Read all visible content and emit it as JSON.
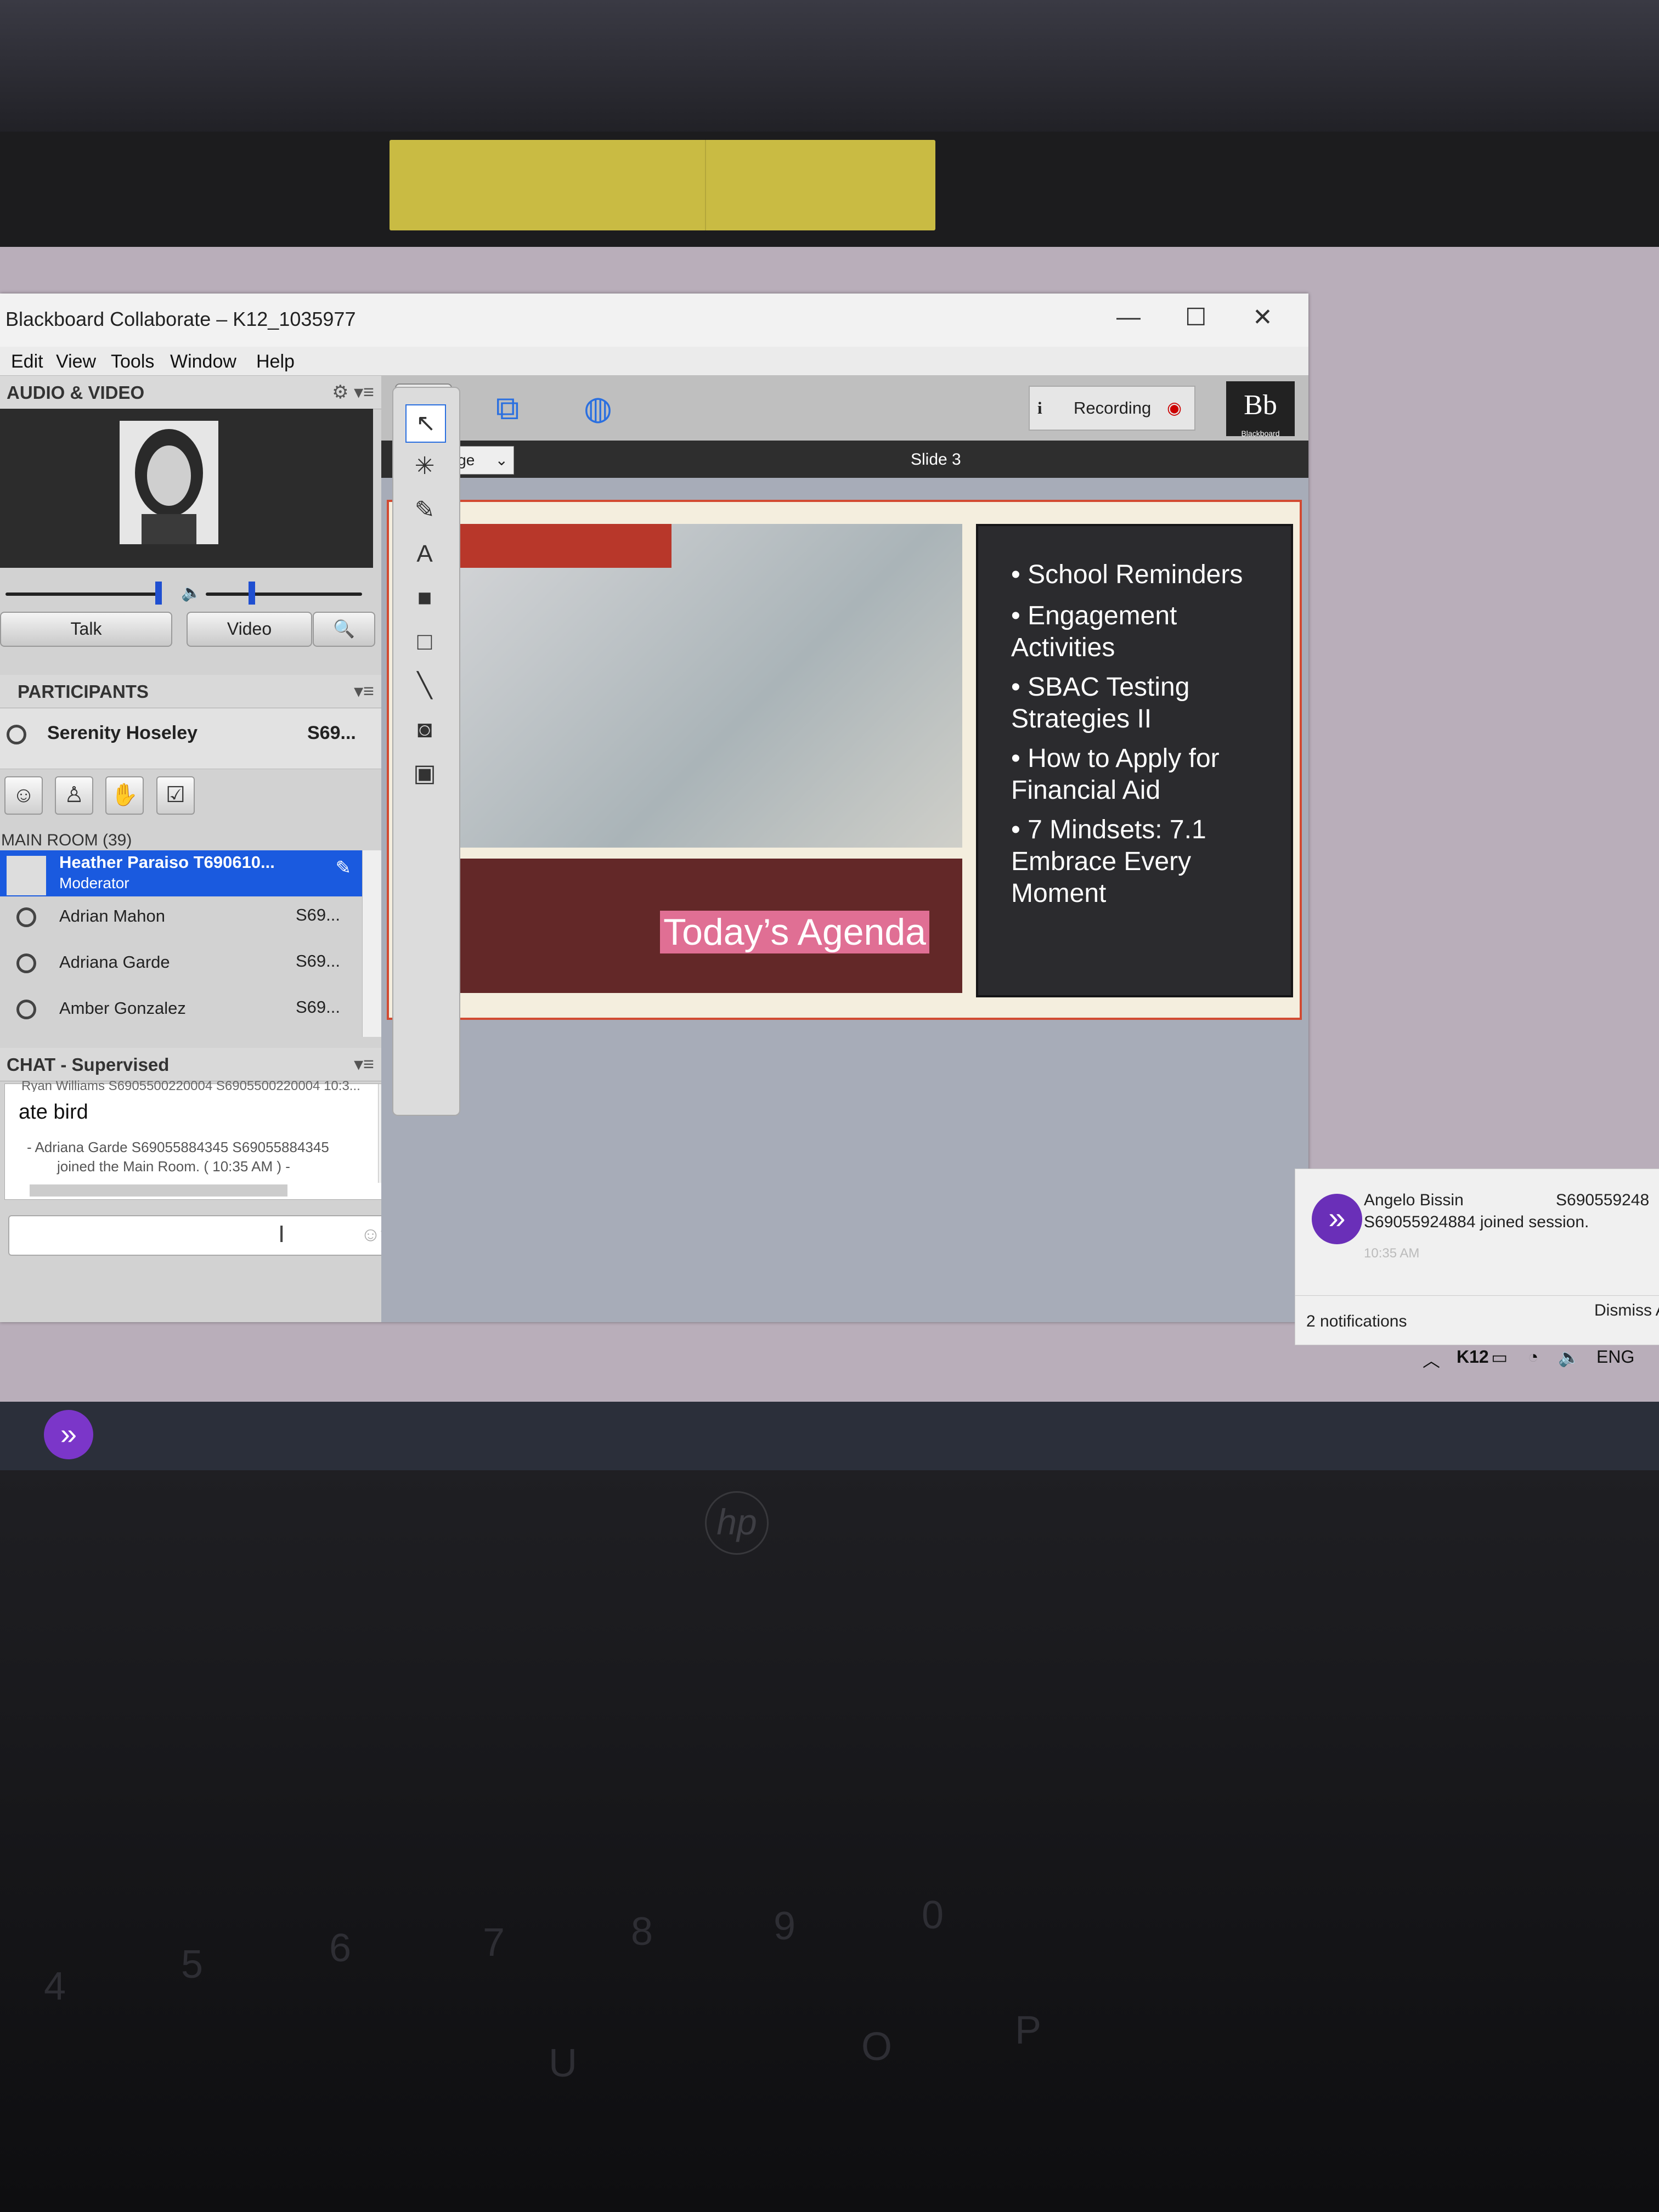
{
  "window": {
    "title": "Blackboard Collaborate – K12_1035977",
    "minimize": "—",
    "maximize": "☐",
    "close": "✕"
  },
  "menu": [
    "Edit",
    "View",
    "Tools",
    "Window",
    "Help"
  ],
  "audio_video": {
    "title": "AUDIO & VIDEO",
    "talk_label": "Talk",
    "video_label": "Video"
  },
  "participants": {
    "title": "PARTICIPANTS",
    "me_name": "Serenity Hoseley",
    "me_id": "S69...",
    "room_label": "MAIN ROOM (39)",
    "list": [
      {
        "name": "Heather Paraiso T690610...",
        "role": "Moderator",
        "id": ""
      },
      {
        "name": "Adrian Mahon",
        "role": "",
        "id": "S69..."
      },
      {
        "name": "Adriana Garde",
        "role": "",
        "id": "S69..."
      },
      {
        "name": "Amber Gonzalez",
        "role": "",
        "id": "S69..."
      }
    ]
  },
  "chat": {
    "title": "CHAT - Supervised",
    "cut_line": "Ryan Williams S6905500220004 S6905500220004 10:3...",
    "message": "ate bird",
    "system_line1": "- Adriana Garde S69055884345 S69055884345",
    "system_line2": "joined the Main Room. ( 10:35 AM ) -"
  },
  "toolbar": {
    "recording_label": "Recording",
    "bb_logo": "Bb",
    "bb_sub": "Blackboard"
  },
  "slide_bar": {
    "fit_label": "Fit Page",
    "slide_label": "Slide 3"
  },
  "slide": {
    "agenda": "Today’s Agenda",
    "bullets": [
      "School Reminders",
      "Engagement Activities",
      "SBAC Testing Strategies II",
      "How to Apply for Financial Aid",
      "7 Mindsets: 7.1 Embrace Every Moment"
    ]
  },
  "notification": {
    "name": "Angelo Bissin",
    "id": "S690559248",
    "text": "S69055924884 joined session.",
    "time": "10:35 AM",
    "count": "2 notifications",
    "dismiss": "Dismiss A"
  },
  "tray": {
    "k12": "K12",
    "lang": "ENG"
  },
  "brand": {
    "laptop": "hp"
  },
  "colors": {
    "moderator_row": "#1a5adf",
    "slide_border": "#d24a32",
    "agenda_highlight": "#e06f94",
    "app_icon": "#7b36c9"
  }
}
